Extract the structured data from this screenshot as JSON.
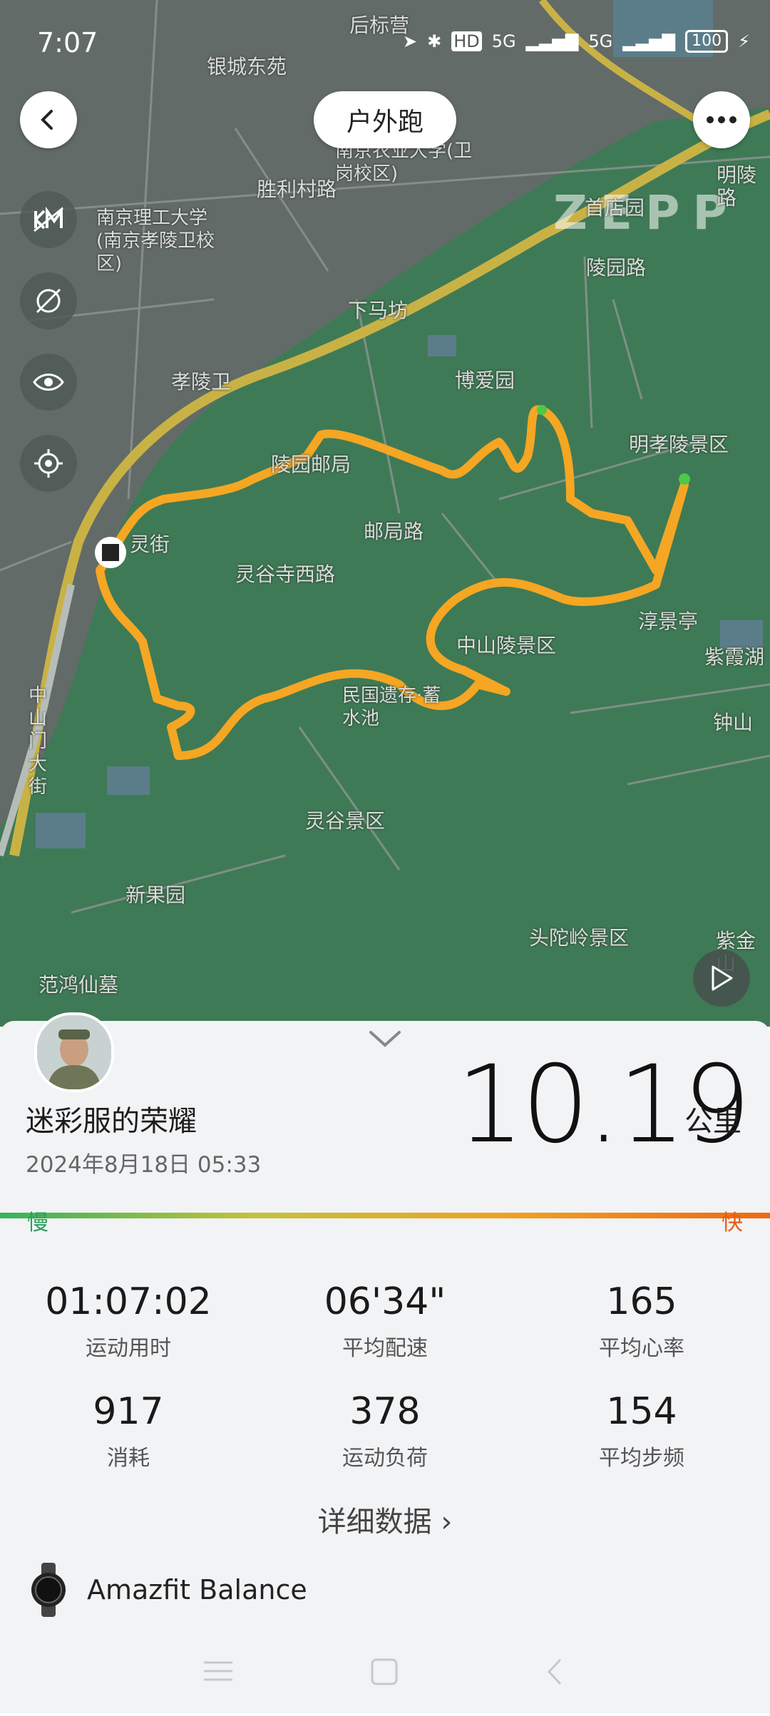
{
  "status_bar": {
    "time": "7:07",
    "hd": "HD",
    "net1": "5G",
    "net2": "5G",
    "battery": "100"
  },
  "header": {
    "title": "户外跑"
  },
  "map": {
    "watermark": "ZEPP",
    "labels": [
      "银城东苑",
      "后标营",
      "南京农业大学(卫岗校区)",
      "南京理工大学(南京孝陵卫校区)",
      "胜利村路",
      "首店园",
      "明陵路",
      "陵园路",
      "下马坊",
      "孝陵卫",
      "博爱园",
      "明孝陵景区",
      "陵园邮局",
      "灵街",
      "邮局路",
      "灵谷寺西路",
      "淳景亭",
      "中山陵景区",
      "民国遗存·蓄水池",
      "紫霞湖",
      "钟山",
      "中山门大街",
      "灵谷景区",
      "新果园",
      "头陀岭景区",
      "紫金山",
      "范鸿仙墓"
    ]
  },
  "summary": {
    "user_name": "迷彩服的荣耀",
    "datetime": "2024年8月18日 05:33",
    "distance": "10.19",
    "distance_unit": "公里",
    "pace_slow": "慢",
    "pace_fast": "快"
  },
  "stats": [
    {
      "value": "01:07:02",
      "label": "运动用时"
    },
    {
      "value": "06'34\"",
      "label": "平均配速"
    },
    {
      "value": "165",
      "label": "平均心率"
    },
    {
      "value": "917",
      "label": "消耗"
    },
    {
      "value": "378",
      "label": "运动负荷"
    },
    {
      "value": "154",
      "label": "平均步频"
    }
  ],
  "detail_link": "详细数据",
  "device": {
    "name": "Amazfit Balance"
  },
  "colors": {
    "route": "#f5a623",
    "route_fast": "#f07a1a",
    "park": "#3f7a56",
    "pace_slow": "#2e9e5a",
    "pace_fast": "#e85d12"
  }
}
